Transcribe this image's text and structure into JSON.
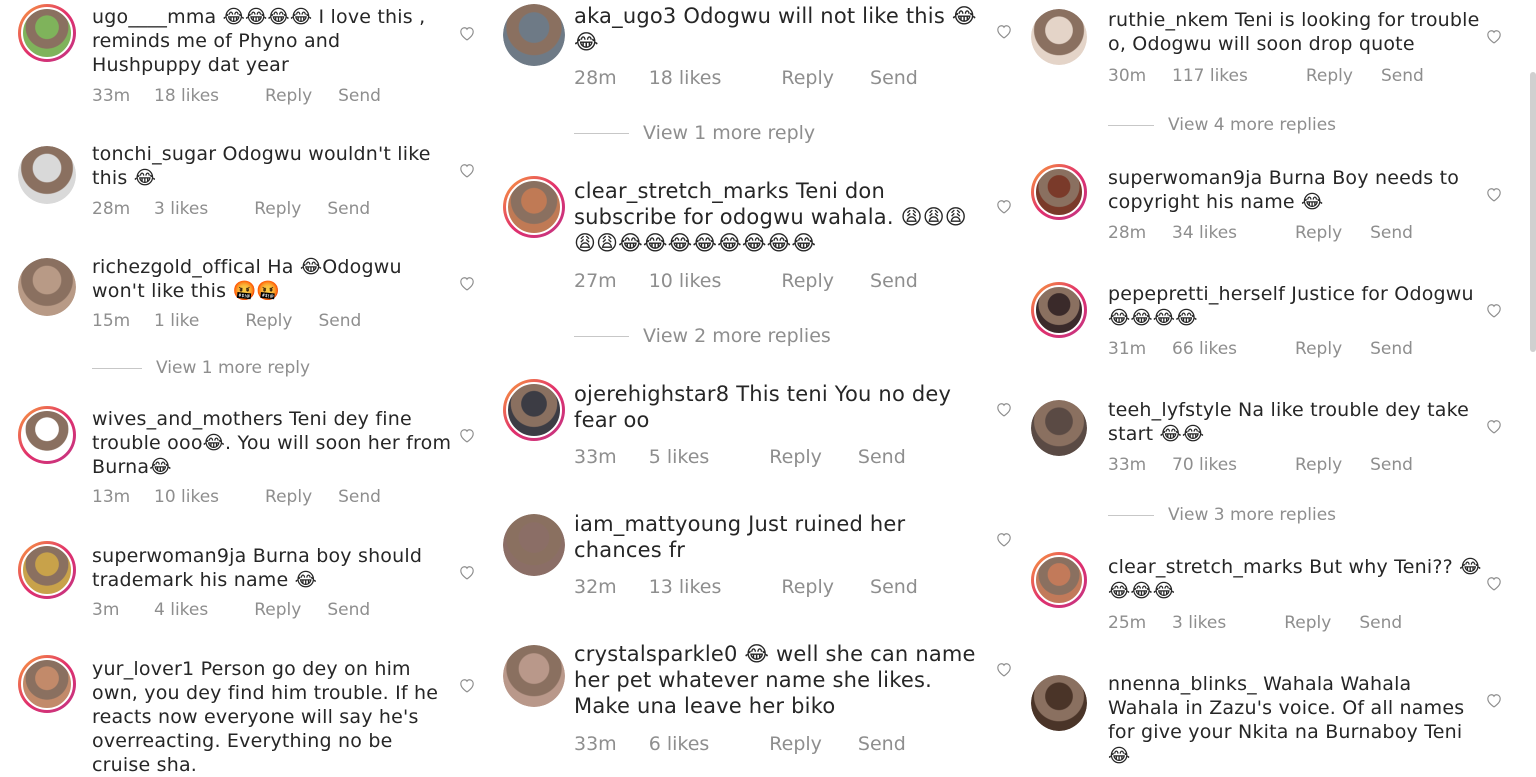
{
  "columns": [
    {
      "comments": [
        {
          "username": "ugo____mma",
          "text": "😂😂😂😂 I love this , reminds me of Phyno and Hushpuppy dat year",
          "time": "33m",
          "likes": "18 likes",
          "reply": "Reply",
          "send": "Send"
        },
        {
          "username": "tonchi_sugar",
          "text": "Odogwu wouldn't like this 😂",
          "time": "28m",
          "likes": "3 likes",
          "reply": "Reply",
          "send": "Send"
        },
        {
          "username": "richezgold_offical",
          "text": "Ha 😂Odogwu won't like this 🤬🤬",
          "time": "15m",
          "likes": "1 like",
          "reply": "Reply",
          "send": "Send",
          "view_more": "View 1 more reply"
        },
        {
          "username": "wives_and_mothers",
          "text": "Teni dey fine trouble ooo😂. You will soon her from Burna😂",
          "time": "13m",
          "likes": "10 likes",
          "reply": "Reply",
          "send": "Send"
        },
        {
          "username": "superwoman9ja",
          "text": "Burna boy should trademark his name 😂",
          "time": "3m",
          "likes": "4 likes",
          "reply": "Reply",
          "send": "Send"
        },
        {
          "username": "yur_lover1",
          "text": "Person go dey on him own, you dey find him trouble. If he reacts now everyone will say he's overreacting. Everything no be cruise sha.",
          "time": "",
          "likes": "",
          "reply": "",
          "send": ""
        }
      ]
    },
    {
      "comments": [
        {
          "username": "aka_ugo3",
          "text": "Odogwu will not like this 😂😂",
          "time": "28m",
          "likes": "18 likes",
          "reply": "Reply",
          "send": "Send",
          "view_more": "View 1 more reply"
        },
        {
          "username": "clear_stretch_marks",
          "text": "Teni don subscribe for odogwu wahala. 😩😩😩😩😩😂😂😂😂😂😂😂😂",
          "time": "27m",
          "likes": "10 likes",
          "reply": "Reply",
          "send": "Send",
          "view_more": "View 2 more replies"
        },
        {
          "username": "ojerehighstar8",
          "text": "This teni You no dey fear oo",
          "time": "33m",
          "likes": "5 likes",
          "reply": "Reply",
          "send": "Send"
        },
        {
          "username": "iam_mattyoung",
          "text": "Just ruined her chances fr",
          "time": "32m",
          "likes": "13 likes",
          "reply": "Reply",
          "send": "Send"
        },
        {
          "username": "crystalsparkle0",
          "text": "😂 well she can name her pet whatever name she likes. Make una leave her biko",
          "time": "33m",
          "likes": "6 likes",
          "reply": "Reply",
          "send": "Send"
        }
      ]
    },
    {
      "comments": [
        {
          "username": "ruthie_nkem",
          "text": "Teni is looking for trouble o, Odogwu will soon drop quote",
          "time": "30m",
          "likes": "117 likes",
          "reply": "Reply",
          "send": "Send",
          "view_more": "View 4 more replies"
        },
        {
          "username": "superwoman9ja",
          "text": "Burna Boy needs to copyright his name 😂",
          "time": "28m",
          "likes": "34 likes",
          "reply": "Reply",
          "send": "Send"
        },
        {
          "username": "pepepretti_herself",
          "text": "Justice for Odogwu 😂😂😂😂",
          "time": "31m",
          "likes": "66 likes",
          "reply": "Reply",
          "send": "Send"
        },
        {
          "username": "teeh_lyfstyle",
          "text": "Na like trouble dey take start 😂😂",
          "time": "33m",
          "likes": "70 likes",
          "reply": "Reply",
          "send": "Send",
          "view_more": "View 3 more replies"
        },
        {
          "username": "clear_stretch_marks",
          "text": "But why Teni?? 😂😂😂😂",
          "time": "25m",
          "likes": "3 likes",
          "reply": "Reply",
          "send": "Send"
        },
        {
          "username": "nnenna_blinks_",
          "text": "Wahala Wahala Wahala in Zazu's voice. Of all names for give your Nkita na Burnaboy Teni 😂",
          "time": "",
          "likes": "",
          "reply": "",
          "send": ""
        }
      ]
    }
  ],
  "colors": {
    "accent_ring_start": "#f9a13a",
    "accent_ring_end": "#c13584",
    "meta": "#8e8e8e",
    "text": "#262626"
  }
}
